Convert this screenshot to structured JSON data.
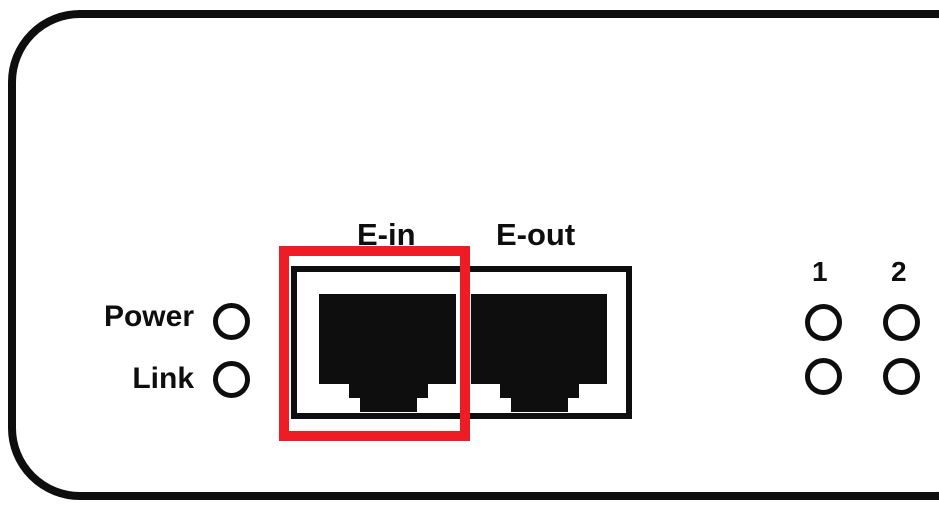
{
  "device": {
    "indicators": {
      "power_label": "Power",
      "link_label": "Link"
    },
    "ports": {
      "ein_label": "E-in",
      "eout_label": "E-out"
    },
    "channels": {
      "first_label": "1",
      "second_label": "2"
    }
  },
  "highlight": {
    "target": "E-in",
    "color": "#ee1c24"
  },
  "colors": {
    "ink": "#0e0e0e",
    "background": "#ffffff"
  }
}
